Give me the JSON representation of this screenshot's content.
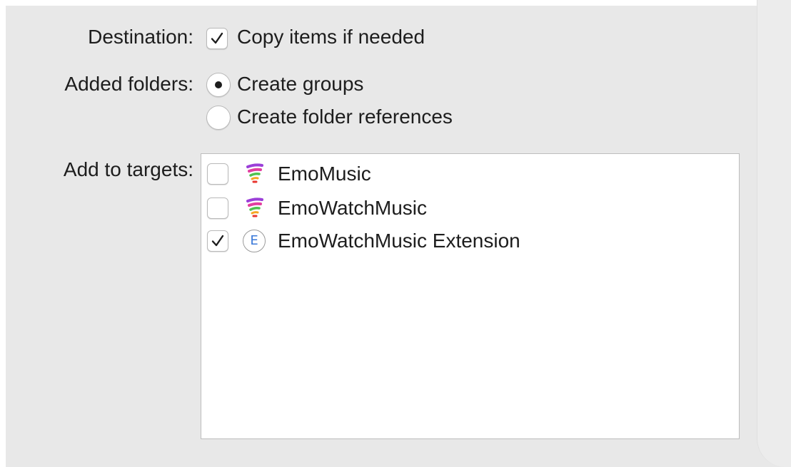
{
  "destination": {
    "label": "Destination:",
    "option_label": "Copy items if needed",
    "checked": true
  },
  "added_folders": {
    "label": "Added folders:",
    "options": [
      {
        "label": "Create groups",
        "selected": true
      },
      {
        "label": "Create folder references",
        "selected": false
      }
    ]
  },
  "targets": {
    "label": "Add to targets:",
    "items": [
      {
        "name": "EmoMusic",
        "checked": false,
        "icon": "emomusic-app-icon"
      },
      {
        "name": "EmoWatchMusic",
        "checked": false,
        "icon": "emomusic-app-icon"
      },
      {
        "name": "EmoWatchMusic Extension",
        "checked": true,
        "icon": "extension-icon",
        "icon_letter": "E"
      }
    ]
  },
  "colors": {
    "panel_background": "#e8e8e8",
    "text": "#1d1d1d",
    "extension_letter": "#3a78d8"
  }
}
